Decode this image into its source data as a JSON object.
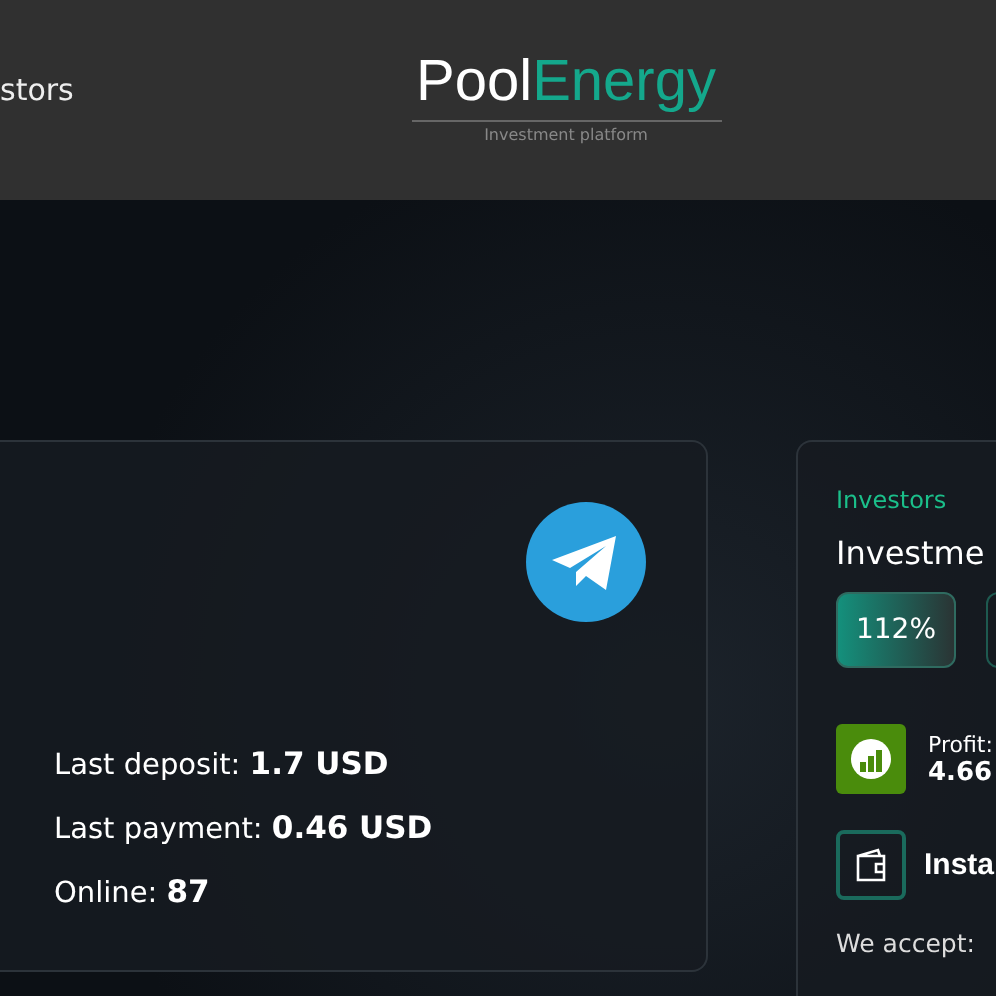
{
  "header": {
    "nav_link": "stors",
    "logo": {
      "first": "Pool",
      "second": "Energy",
      "tagline": "Investment platform"
    }
  },
  "stats_card": {
    "stats": [
      {
        "label": "Last deposit:",
        "value": "1.7 USD"
      },
      {
        "label": "Last payment:",
        "value": "0.46 USD"
      },
      {
        "label": "Online:",
        "value": "87"
      }
    ]
  },
  "investors_card": {
    "eyebrow": "Investors",
    "title": "Investme",
    "plans": [
      {
        "label": "112%",
        "selected": true
      },
      {
        "selected": false
      }
    ],
    "profit": {
      "label": "Profit:",
      "value": "4.66"
    },
    "instant": "Insta",
    "accept": "We accept:"
  }
}
